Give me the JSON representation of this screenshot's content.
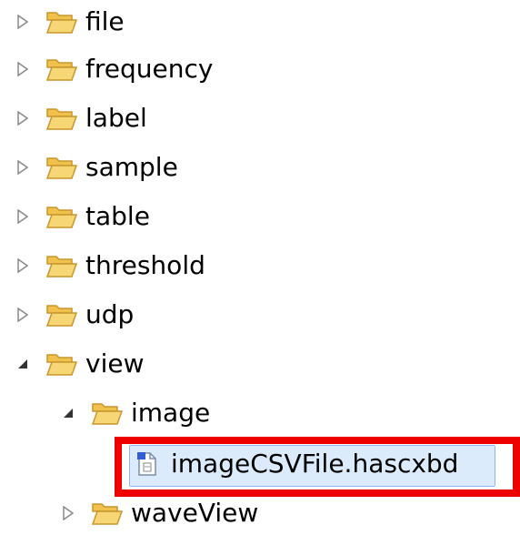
{
  "tree": {
    "items": [
      {
        "label": "file",
        "expanded": false,
        "type": "folder"
      },
      {
        "label": "frequency",
        "expanded": false,
        "type": "folder"
      },
      {
        "label": "label",
        "expanded": false,
        "type": "folder"
      },
      {
        "label": "sample",
        "expanded": false,
        "type": "folder"
      },
      {
        "label": "table",
        "expanded": false,
        "type": "folder"
      },
      {
        "label": "threshold",
        "expanded": false,
        "type": "folder"
      },
      {
        "label": "udp",
        "expanded": false,
        "type": "folder"
      },
      {
        "label": "view",
        "expanded": true,
        "type": "folder"
      },
      {
        "label": "image",
        "expanded": true,
        "type": "folder"
      },
      {
        "label": "imageCSVFile.hascxbd",
        "type": "file",
        "selected": true
      },
      {
        "label": "waveView",
        "expanded": false,
        "type": "folder"
      }
    ]
  },
  "colors": {
    "folder_fill": "#f7d775",
    "folder_stroke": "#c8962f",
    "selection_bg": "#dcebfb",
    "selection_border": "#8fb8e6",
    "highlight": "#ee0000"
  }
}
